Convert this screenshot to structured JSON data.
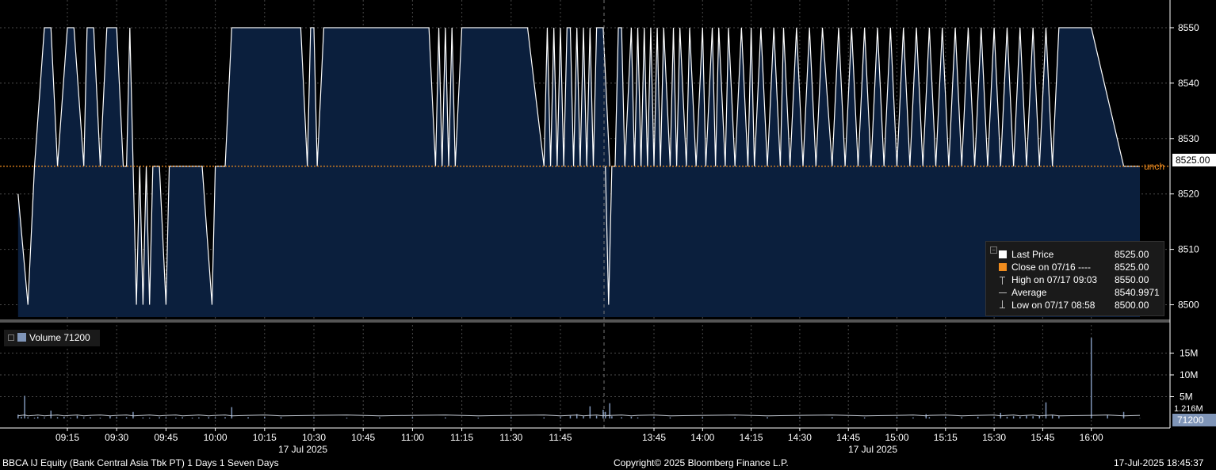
{
  "chart_data": [
    {
      "type": "area",
      "panel": "price",
      "date_label": "17 Jul 2025",
      "unch_label": "unch",
      "close_prev": 8525.0,
      "last_price_tag": "8525.00",
      "y_ticks": [
        "8500",
        "8510",
        "8520",
        "8530",
        "8540",
        "8550"
      ],
      "ylim": [
        8497.5,
        8555
      ],
      "grid": true,
      "legend_placement": "bottom-right",
      "colors": {
        "fill": "#0b1f3d",
        "line": "#ffffff",
        "close_line": "#f08c1e",
        "grid": "#555555"
      },
      "sessions": [
        {
          "name": "morning",
          "x_ticks": [
            "09:15",
            "09:30",
            "09:45",
            "10:00",
            "10:15",
            "10:30",
            "10:45",
            "11:00",
            "11:15",
            "11:30",
            "11:45"
          ],
          "x": [
            "09:00",
            "09:03",
            "09:05",
            "09:08",
            "09:10",
            "09:12",
            "09:15",
            "09:17",
            "09:20",
            "09:21",
            "09:23",
            "09:25",
            "09:27",
            "09:30",
            "09:32",
            "09:33",
            "09:34",
            "09:35",
            "09:36",
            "09:37",
            "09:38",
            "09:39",
            "09:40",
            "09:41",
            "09:43",
            "09:45",
            "09:46",
            "09:48",
            "09:50",
            "09:53",
            "09:56",
            "09:59",
            "10:00",
            "10:03",
            "10:05",
            "10:06",
            "10:08",
            "10:10",
            "10:15",
            "10:20",
            "10:26",
            "10:28",
            "10:29",
            "10:30",
            "10:31",
            "10:33",
            "10:35",
            "10:40",
            "10:45",
            "11:00",
            "11:05",
            "11:07",
            "11:08",
            "11:09",
            "11:10",
            "11:11",
            "11:12",
            "11:13",
            "11:15",
            "11:16",
            "11:18",
            "11:20",
            "11:25",
            "11:30",
            "11:35",
            "11:40",
            "11:41",
            "11:42",
            "11:43",
            "11:44",
            "11:45",
            "11:46",
            "11:47",
            "11:48",
            "11:49",
            "11:50",
            "11:51",
            "11:52",
            "11:53",
            "11:54",
            "11:55",
            "11:56",
            "11:58",
            "12:00"
          ],
          "y": [
            8520,
            8500,
            8525,
            8550,
            8550,
            8525,
            8550,
            8550,
            8525,
            8550,
            8550,
            8525,
            8550,
            8550,
            8525,
            8525,
            8550,
            8525,
            8500,
            8525,
            8500,
            8525,
            8500,
            8525,
            8525,
            8500,
            8525,
            8525,
            8525,
            8525,
            8525,
            8500,
            8525,
            8525,
            8550,
            8550,
            8550,
            8550,
            8550,
            8550,
            8550,
            8525,
            8550,
            8550,
            8525,
            8550,
            8550,
            8550,
            8550,
            8550,
            8550,
            8525,
            8550,
            8525,
            8550,
            8525,
            8550,
            8525,
            8550,
            8550,
            8550,
            8550,
            8550,
            8550,
            8550,
            8525,
            8550,
            8525,
            8550,
            8525,
            8550,
            8525,
            8550,
            8550,
            8525,
            8550,
            8525,
            8550,
            8525,
            8550,
            8525,
            8550,
            8550,
            8525
          ]
        },
        {
          "name": "afternoon",
          "x_ticks": [
            "13:45",
            "14:00",
            "14:15",
            "14:30",
            "14:45",
            "15:00",
            "15:15",
            "15:30",
            "15:45",
            "16:00"
          ],
          "x": [
            "13:30",
            "13:31",
            "13:32",
            "13:33",
            "13:34",
            "13:35",
            "13:36",
            "13:38",
            "13:39",
            "13:40",
            "13:41",
            "13:42",
            "13:43",
            "13:44",
            "13:45",
            "13:46",
            "13:47",
            "13:48",
            "13:50",
            "13:51",
            "13:52",
            "13:53",
            "13:55",
            "13:56",
            "13:58",
            "14:00",
            "14:01",
            "14:03",
            "14:04",
            "14:05",
            "14:07",
            "14:08",
            "14:10",
            "14:12",
            "14:14",
            "14:15",
            "14:16",
            "14:18",
            "14:20",
            "14:22",
            "14:24",
            "14:25",
            "14:27",
            "14:29",
            "14:31",
            "14:33",
            "14:35",
            "14:37",
            "14:40",
            "14:42",
            "14:44",
            "14:46",
            "14:48",
            "14:50",
            "14:52",
            "14:54",
            "14:56",
            "14:58",
            "15:00",
            "15:02",
            "15:04",
            "15:06",
            "15:08",
            "15:10",
            "15:12",
            "15:14",
            "15:16",
            "15:18",
            "15:20",
            "15:22",
            "15:24",
            "15:26",
            "15:28",
            "15:30",
            "15:32",
            "15:34",
            "15:36",
            "15:38",
            "15:40",
            "15:42",
            "15:44",
            "15:46",
            "15:48",
            "15:50",
            "16:00",
            "16:10",
            "16:15"
          ],
          "y": [
            8525,
            8500,
            8525,
            8525,
            8550,
            8550,
            8525,
            8550,
            8525,
            8550,
            8525,
            8550,
            8525,
            8550,
            8525,
            8550,
            8525,
            8550,
            8525,
            8550,
            8525,
            8550,
            8525,
            8550,
            8525,
            8550,
            8525,
            8550,
            8525,
            8550,
            8525,
            8550,
            8525,
            8550,
            8525,
            8550,
            8525,
            8550,
            8525,
            8550,
            8525,
            8550,
            8525,
            8550,
            8525,
            8550,
            8525,
            8550,
            8525,
            8550,
            8525,
            8550,
            8525,
            8550,
            8525,
            8550,
            8525,
            8550,
            8525,
            8550,
            8525,
            8550,
            8525,
            8550,
            8525,
            8550,
            8525,
            8550,
            8525,
            8550,
            8525,
            8550,
            8525,
            8550,
            8525,
            8550,
            8525,
            8550,
            8525,
            8550,
            8525,
            8550,
            8525,
            8550,
            8550,
            8525,
            8525
          ]
        }
      ]
    },
    {
      "type": "bar",
      "panel": "volume",
      "y_ticks": [
        "5M",
        "10M",
        "15M"
      ],
      "last_volume_tag": "71200",
      "avg_label": "1.216M",
      "ylim": [
        0,
        20000000
      ],
      "grid": true,
      "colors": {
        "bar": "#7f95b8",
        "avg_line": "#cfd6e0"
      },
      "sessions": [
        {
          "name": "morning",
          "x": [
            "09:00",
            "09:01",
            "09:02",
            "09:03",
            "09:05",
            "09:06",
            "09:08",
            "09:10",
            "09:12",
            "09:14",
            "09:16",
            "09:18",
            "09:20",
            "09:22",
            "09:25",
            "09:28",
            "09:30",
            "09:33",
            "09:35",
            "09:38",
            "09:40",
            "09:43",
            "09:45",
            "09:48",
            "09:50",
            "09:53",
            "09:55",
            "09:58",
            "10:00",
            "10:03",
            "10:05",
            "10:10",
            "10:15",
            "10:20",
            "10:30",
            "10:40",
            "10:50",
            "11:00",
            "11:10",
            "11:20",
            "11:30",
            "11:40",
            "11:45",
            "11:48",
            "11:50",
            "11:52",
            "11:54",
            "11:56",
            "11:58",
            "12:00"
          ],
          "values": [
            900000,
            400000,
            5200000,
            300000,
            200000,
            400000,
            250000,
            1800000,
            300000,
            350000,
            200000,
            600000,
            250000,
            300000,
            200000,
            500000,
            300000,
            300000,
            1500000,
            250000,
            200000,
            300000,
            250000,
            200000,
            300000,
            200000,
            250000,
            300000,
            250000,
            300000,
            2600000,
            300000,
            350000,
            300000,
            250000,
            200000,
            250000,
            300000,
            250000,
            200000,
            300000,
            250000,
            300000,
            600000,
            1000000,
            500000,
            2800000,
            600000,
            2000000,
            3500000
          ]
        },
        {
          "name": "afternoon",
          "x": [
            "13:30",
            "13:32",
            "13:35",
            "13:38",
            "13:40",
            "13:45",
            "13:50",
            "14:00",
            "14:10",
            "14:20",
            "14:30",
            "14:40",
            "14:50",
            "15:00",
            "15:05",
            "15:09",
            "15:10",
            "15:15",
            "15:20",
            "15:25",
            "15:30",
            "15:32",
            "15:34",
            "15:36",
            "15:38",
            "15:40",
            "15:42",
            "15:44",
            "15:46",
            "15:48",
            "15:50",
            "16:00",
            "16:05",
            "16:10",
            "16:15"
          ],
          "values": [
            1500000,
            500000,
            300000,
            400000,
            250000,
            300000,
            250000,
            300000,
            250000,
            300000,
            250000,
            300000,
            250000,
            300000,
            250000,
            1000000,
            300000,
            350000,
            300000,
            400000,
            300000,
            1300000,
            400000,
            500000,
            400000,
            600000,
            500000,
            700000,
            3700000,
            700000,
            500000,
            18500000,
            800000,
            1500000,
            71200
          ]
        }
      ]
    }
  ],
  "legend": {
    "rows": [
      {
        "label": "Last Price",
        "value": "8525.00",
        "color": "#ffffff",
        "symbol": "square"
      },
      {
        "label": "Close on 07/16 ----",
        "value": "8525.00",
        "color": "#f08c1e",
        "symbol": "square"
      },
      {
        "label": "High on 07/17 09:03",
        "value": "8550.00",
        "color": "#bbbbbb",
        "symbol": "high-marker"
      },
      {
        "label": "Average",
        "value": "8540.9971",
        "color": "#bbbbbb",
        "symbol": "average-marker"
      },
      {
        "label": "Low on 07/17 08:58",
        "value": "8500.00",
        "color": "#bbbbbb",
        "symbol": "low-marker"
      }
    ]
  },
  "volume_legend": {
    "label": "Volume 71200"
  },
  "footer": {
    "security": "BBCA IJ Equity (Bank Central Asia Tbk PT) 1 Days 1 Seven Days",
    "copyright": "Copyright© 2025 Bloomberg Finance L.P.",
    "timestamp": "17-Jul-2025 18:45:37"
  }
}
